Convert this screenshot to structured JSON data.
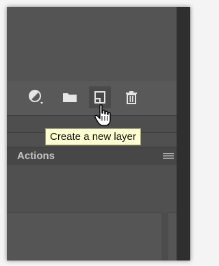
{
  "toolbar": {
    "buttons": [
      {
        "icon": "adjustment-layer-icon"
      },
      {
        "icon": "folder-icon"
      },
      {
        "icon": "new-layer-icon"
      },
      {
        "icon": "trash-icon"
      }
    ]
  },
  "tooltip": {
    "text": "Create a new layer"
  },
  "actions_panel": {
    "title": "Actions",
    "menu_icon": "panel-menu-icon"
  },
  "colors": {
    "panel": "#505050",
    "tooltip_bg": "#fdfdd0",
    "dark_strip": "#2f2f2f"
  }
}
